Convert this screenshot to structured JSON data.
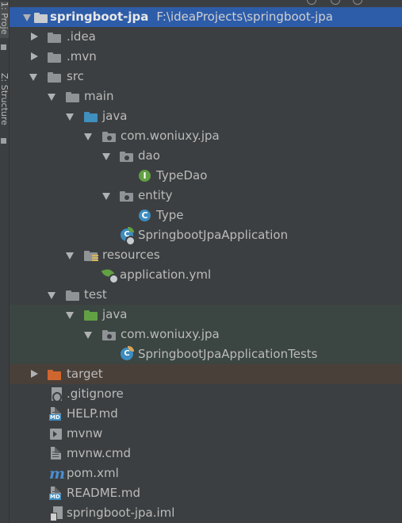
{
  "sidebar": {
    "project_tab": "1: Proje",
    "structure_tab": "Z: Structure"
  },
  "tree": {
    "root": {
      "name": "springboot-jpa",
      "path": "F:\\ideaProjects\\springboot-jpa"
    },
    "items": [
      {
        "label": ".idea"
      },
      {
        "label": ".mvn"
      },
      {
        "label": "src"
      },
      {
        "label": "main"
      },
      {
        "label": "java"
      },
      {
        "label": "com.woniuxy.jpa"
      },
      {
        "label": "dao"
      },
      {
        "label": "TypeDao"
      },
      {
        "label": "entity"
      },
      {
        "label": "Type"
      },
      {
        "label": "SpringbootJpaApplication"
      },
      {
        "label": "resources"
      },
      {
        "label": "application.yml"
      },
      {
        "label": "test"
      },
      {
        "label": "java"
      },
      {
        "label": "com.woniuxy.jpa"
      },
      {
        "label": "SpringbootJpaApplicationTests"
      },
      {
        "label": "target"
      },
      {
        "label": ".gitignore"
      },
      {
        "label": "HELP.md"
      },
      {
        "label": "mvnw"
      },
      {
        "label": "mvnw.cmd"
      },
      {
        "label": "pom.xml"
      },
      {
        "label": "README.md"
      },
      {
        "label": "springboot-jpa.iml"
      }
    ]
  },
  "icons": {
    "interface_letter": "I",
    "class_letter": "C",
    "md_badge": "MD",
    "maven_glyph": "m"
  },
  "colors": {
    "background": "#3c3f41",
    "selection": "#2d5ca9",
    "test_row": "#3b4541",
    "excluded_row": "#4a403a",
    "source_folder": "#3f8fbf",
    "test_folder": "#62a044",
    "excluded_folder": "#d0662f"
  }
}
